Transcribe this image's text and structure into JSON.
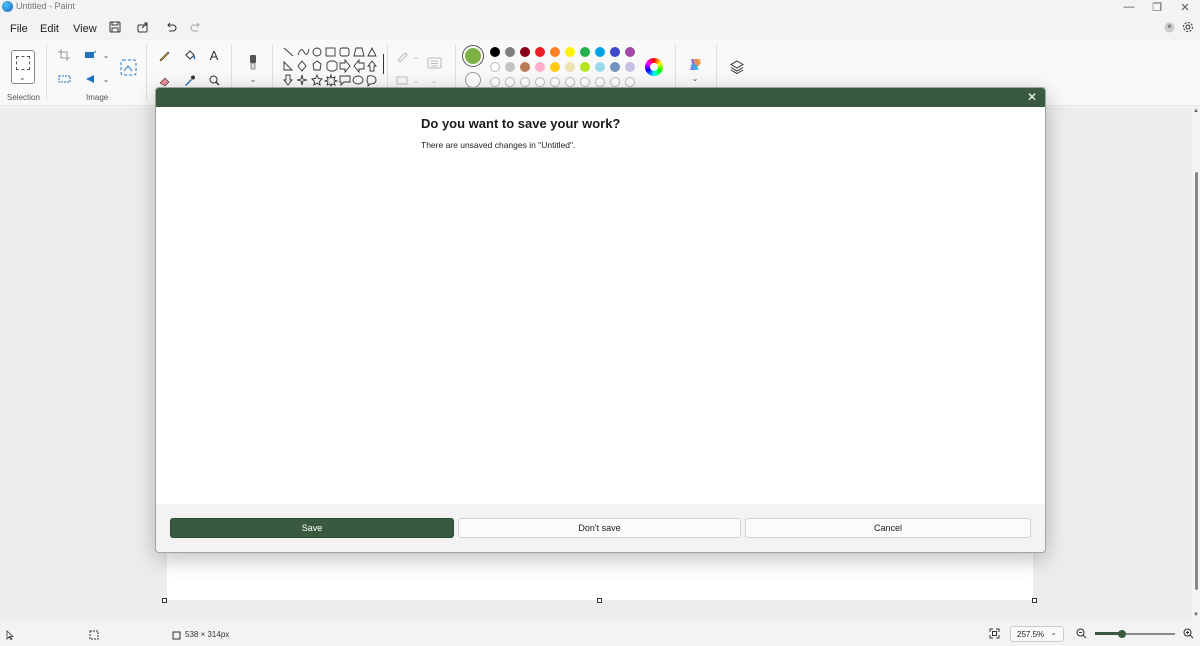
{
  "window": {
    "title": "Untitled - Paint",
    "minimize_glyph": "—",
    "restore_glyph": "❐",
    "close_glyph": "✕"
  },
  "menu": {
    "file": "File",
    "edit": "Edit",
    "view": "View"
  },
  "ribbon": {
    "groups": {
      "selection": "Selection",
      "image": "Image"
    },
    "colors": {
      "primary": "#7cb342",
      "secondary": "#ffffff",
      "palette_row1": [
        "#000000",
        "#7f7f7f",
        "#880015",
        "#ed1c24",
        "#ff7f27",
        "#fff200",
        "#22b14c",
        "#00a2e8",
        "#3f48cc",
        "#a349a4"
      ],
      "palette_row2": [
        "#ffffff",
        "#c3c3c3",
        "#b97a57",
        "#ffaec9",
        "#ffc90e",
        "#efe4b0",
        "#b5e61d",
        "#99d9ea",
        "#7092be",
        "#c8bfe7"
      ]
    }
  },
  "dialog": {
    "title": "Do you want to save your work?",
    "message": "There are unsaved changes in \"Untitled\".",
    "save_label": "Save",
    "dont_save_label": "Don't save",
    "cancel_label": "Cancel",
    "header_color": "#3a5a40"
  },
  "status": {
    "canvas_size": "538 × 314px",
    "zoom": "257.5%"
  }
}
